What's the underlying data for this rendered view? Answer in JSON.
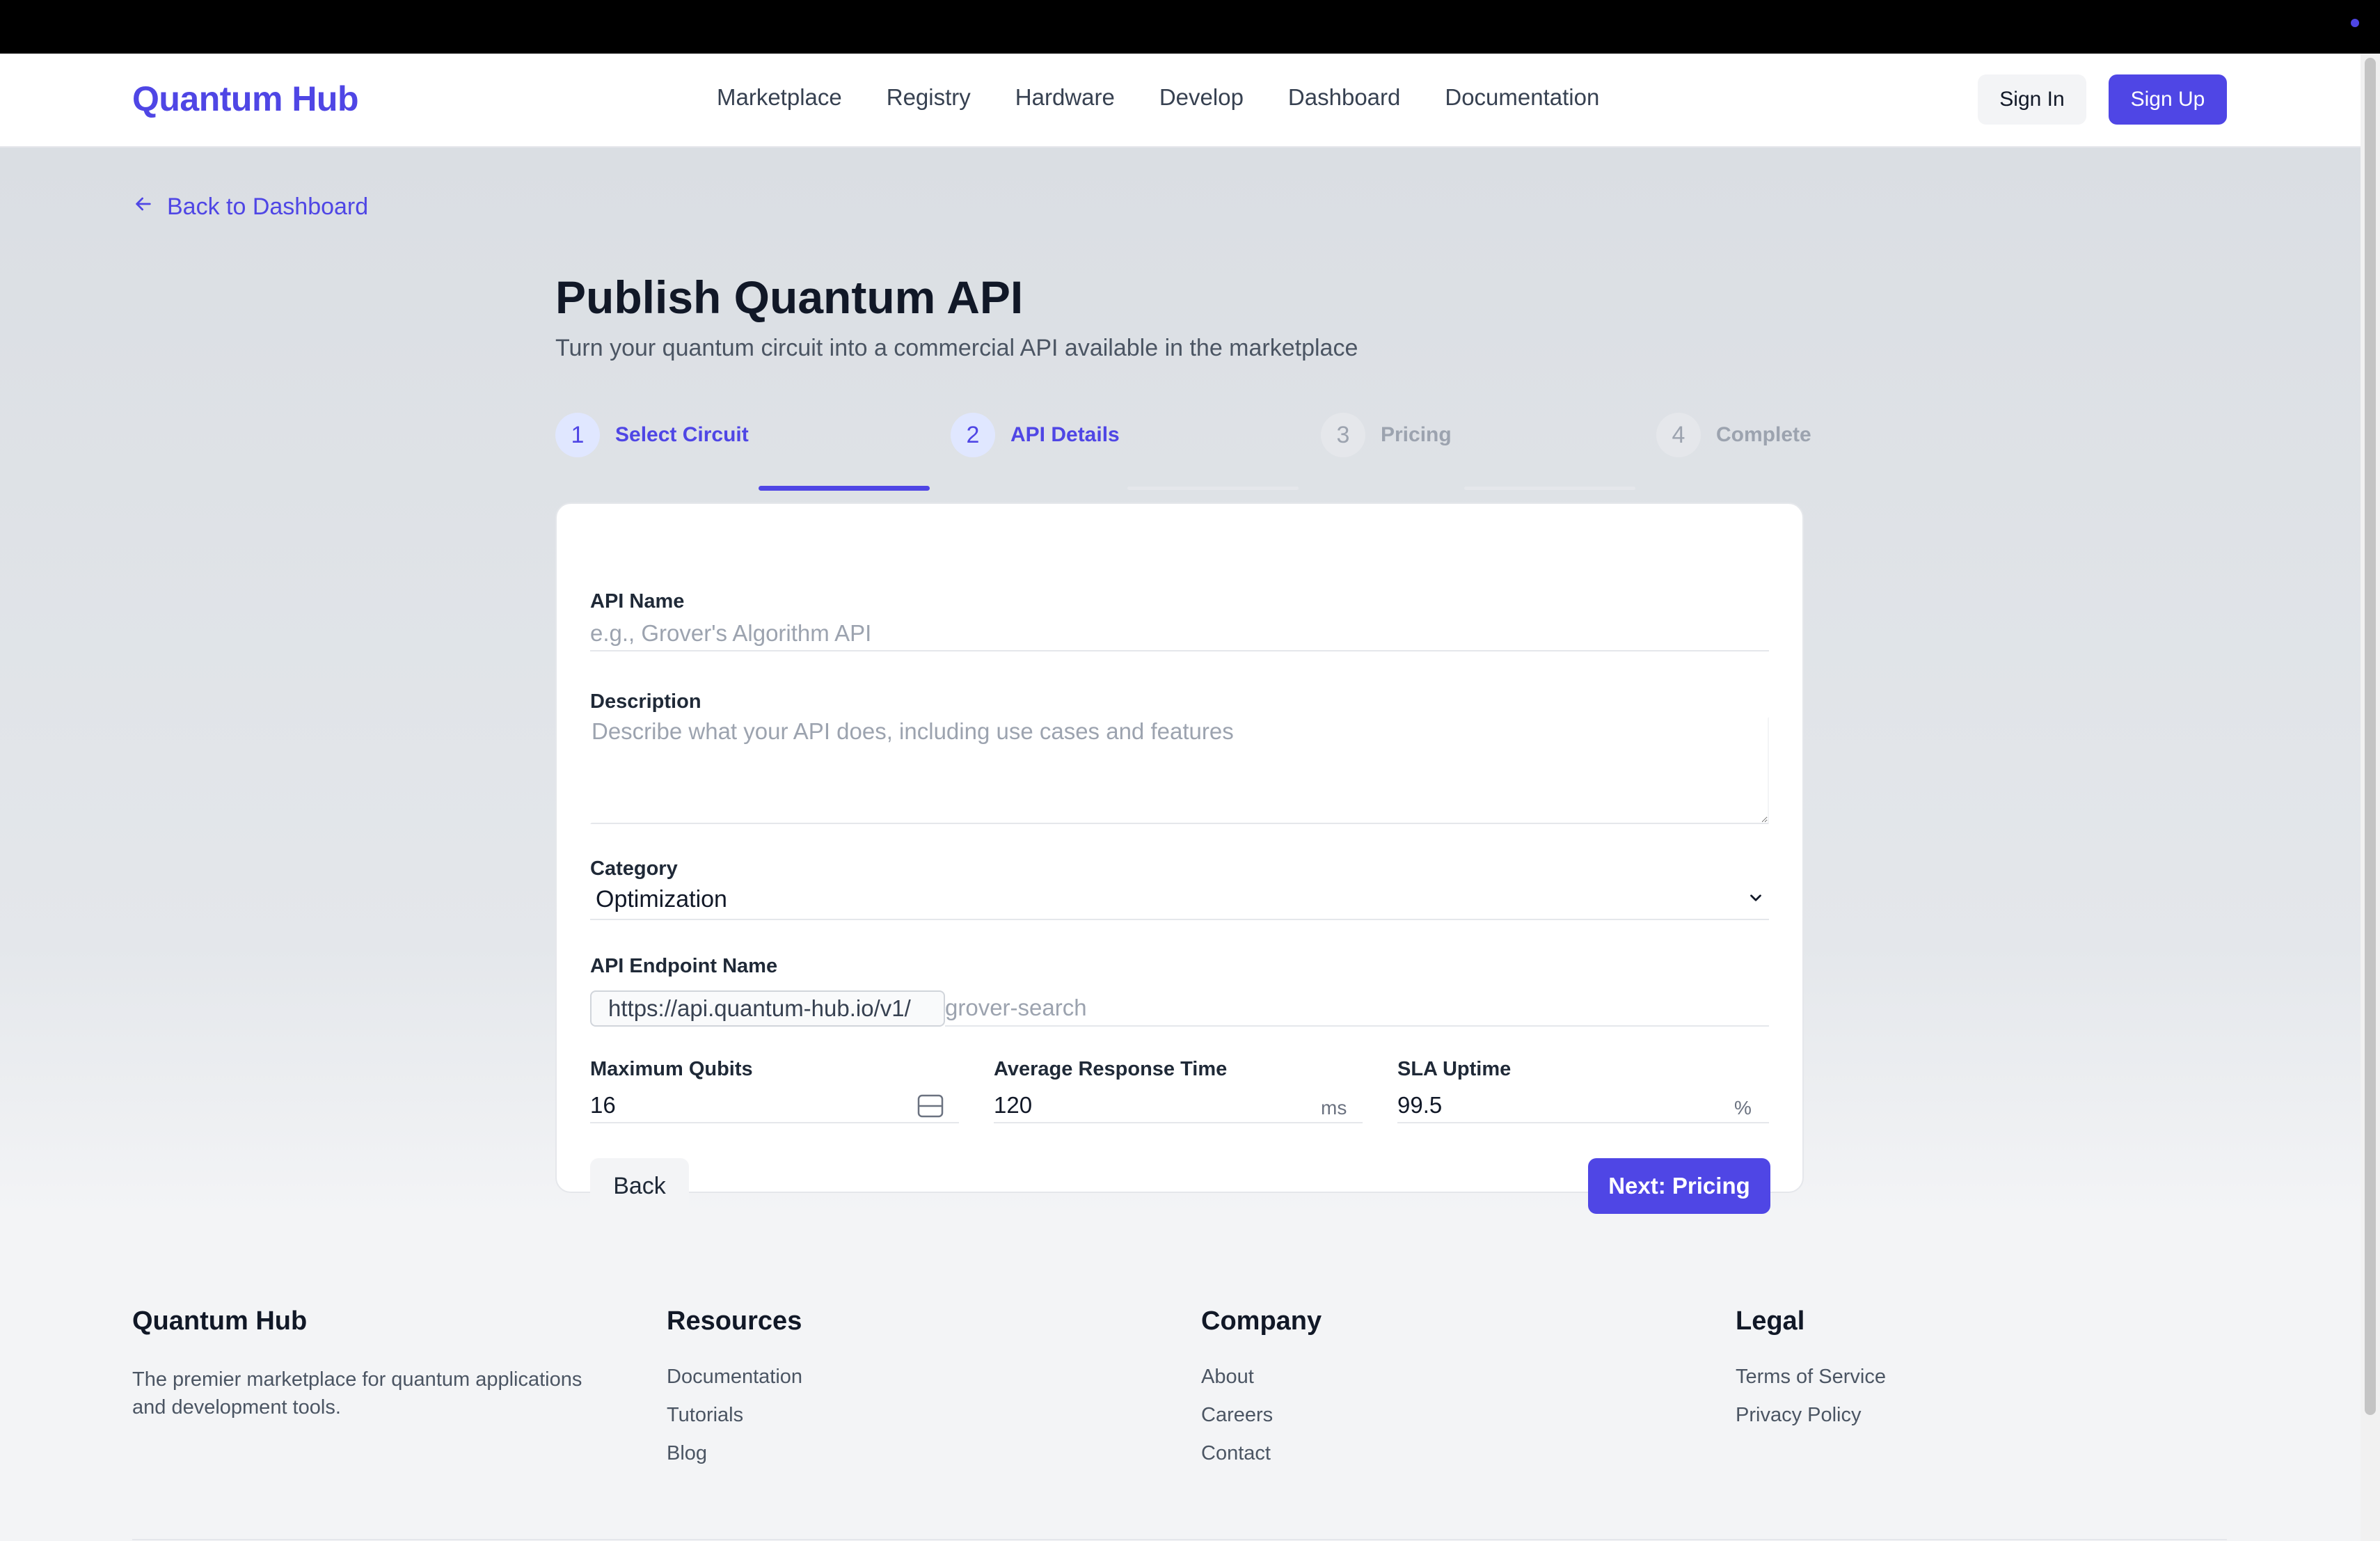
{
  "brand": {
    "name": "Quantum Hub",
    "accent": "#4f46e5"
  },
  "nav": {
    "items": [
      "Marketplace",
      "Registry",
      "Hardware",
      "Develop",
      "Dashboard",
      "Documentation"
    ],
    "sign_in": "Sign In",
    "sign_up": "Sign Up"
  },
  "back_link": "Back to Dashboard",
  "page": {
    "title": "Publish Quantum API",
    "subtitle": "Turn your quantum circuit into a commercial API available in the marketplace"
  },
  "stepper": [
    {
      "num": "1",
      "label": "Select Circuit",
      "state": "done"
    },
    {
      "num": "2",
      "label": "API Details",
      "state": "current"
    },
    {
      "num": "3",
      "label": "Pricing",
      "state": "upcoming"
    },
    {
      "num": "4",
      "label": "Complete",
      "state": "upcoming"
    }
  ],
  "form": {
    "api_name": {
      "label": "API Name",
      "value": "",
      "placeholder": "e.g., Grover's Algorithm API"
    },
    "description": {
      "label": "Description",
      "value": "",
      "placeholder": "Describe what your API does, including use cases and features"
    },
    "category": {
      "label": "Category",
      "value": "Optimization"
    },
    "endpoint": {
      "label": "API Endpoint Name",
      "prefix": "https://api.quantum-hub.io/v1/",
      "value": "",
      "placeholder": "grover-search"
    },
    "max_qubits": {
      "label": "Maximum Qubits",
      "value": "16"
    },
    "response_time": {
      "label": "Average Response Time",
      "value": "120",
      "unit": "ms"
    },
    "sla_uptime": {
      "label": "SLA Uptime",
      "value": "99.5",
      "unit": "%"
    },
    "back_button": "Back",
    "next_button": "Next: Pricing"
  },
  "footer": {
    "about": {
      "title": "Quantum Hub",
      "text": "The premier marketplace for quantum applications and development tools."
    },
    "resources": {
      "title": "Resources",
      "links": [
        "Documentation",
        "Tutorials",
        "Blog"
      ]
    },
    "company": {
      "title": "Company",
      "links": [
        "About",
        "Careers",
        "Contact"
      ]
    },
    "legal": {
      "title": "Legal",
      "links": [
        "Terms of Service",
        "Privacy Policy"
      ]
    }
  }
}
